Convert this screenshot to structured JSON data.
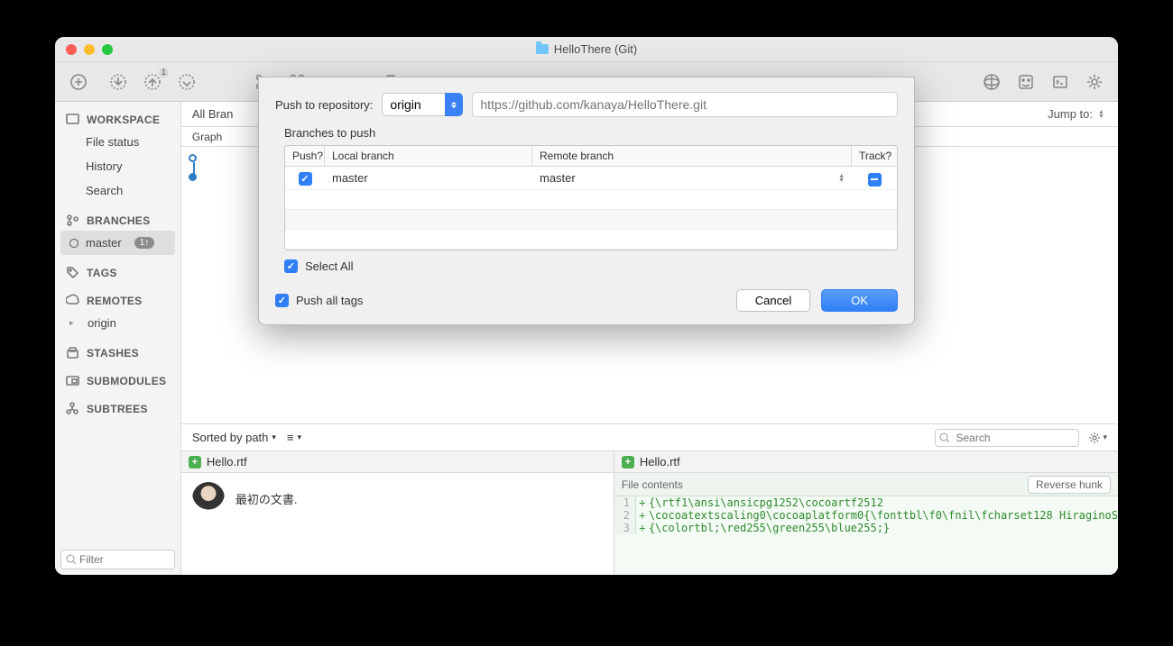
{
  "window": {
    "title": "HelloThere (Git)"
  },
  "toolbar": {
    "push_badge": "1"
  },
  "sidebar": {
    "sections": {
      "workspace": "WORKSPACE",
      "branches": "BRANCHES",
      "tags": "TAGS",
      "remotes": "REMOTES",
      "stashes": "STASHES",
      "submodules": "SUBMODULES",
      "subtrees": "SUBTREES"
    },
    "workspace_items": [
      "File status",
      "History",
      "Search"
    ],
    "branch_items": [
      {
        "name": "master",
        "badge": "1↑"
      }
    ],
    "remote_items": [
      "origin"
    ],
    "filter_placeholder": "Filter"
  },
  "tabs": {
    "all_branches": "All Bran",
    "jump_label": "Jump to:"
  },
  "graph_label": "Graph",
  "lower": {
    "sort_label": "Sorted by path",
    "search_placeholder": "Search",
    "file_name_left": "Hello.rtf",
    "file_name_right": "Hello.rtf",
    "commit_message": "最初の文書.",
    "diff_header": "File contents",
    "reverse_hunk": "Reverse hunk",
    "diff_lines": [
      {
        "n": "1",
        "t": "{\\rtf1\\ansi\\ansicpg1252\\cocoartf2512"
      },
      {
        "n": "2",
        "t": "\\cocoatextscaling0\\cocoaplatform0{\\fonttbl\\f0\\fnil\\fcharset128 HiraginoS"
      },
      {
        "n": "3",
        "t": "{\\colortbl;\\red255\\green255\\blue255;}"
      }
    ]
  },
  "dialog": {
    "push_to_label": "Push to repository:",
    "remote": "origin",
    "url_placeholder": "https://github.com/kanaya/HelloThere.git",
    "branches_label": "Branches to push",
    "cols": {
      "push": "Push?",
      "local": "Local branch",
      "remote": "Remote branch",
      "track": "Track?"
    },
    "rows": [
      {
        "local": "master",
        "remote": "master"
      }
    ],
    "select_all": "Select All",
    "push_all_tags": "Push all tags",
    "cancel": "Cancel",
    "ok": "OK"
  }
}
